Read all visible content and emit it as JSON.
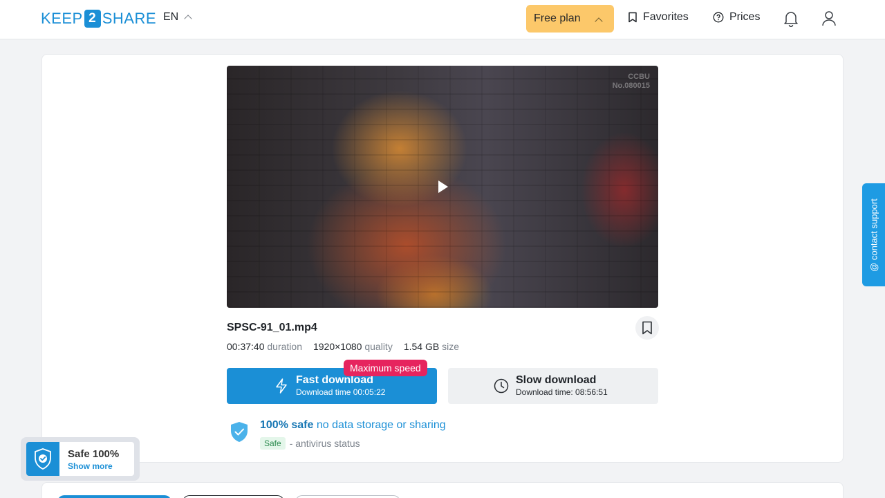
{
  "header": {
    "logo_left": "KEEP",
    "logo_mid": "2",
    "logo_right": "SHARE",
    "lang": "EN",
    "free_plan": "Free plan",
    "favorites": "Favorites",
    "prices": "Prices"
  },
  "video": {
    "watermark_line1": "CCBU",
    "watermark_line2": "No.080015"
  },
  "file": {
    "name": "SPSC-91_01.mp4",
    "duration_value": "00:37:40",
    "duration_label": "duration",
    "quality_value": "1920×1080",
    "quality_label": "quality",
    "size_value": "1.54 GB",
    "size_label": "size"
  },
  "download": {
    "badge": "Maximum speed",
    "fast_title": "Fast download",
    "fast_sub": "Download time 00:05:22",
    "slow_title": "Slow download",
    "slow_sub": "Download time: 08:56:51"
  },
  "safety": {
    "bold": "100% safe",
    "rest": " no data storage or sharing",
    "chip": "Safe",
    "status": "- antivirus status"
  },
  "floater": {
    "title": "Safe 100%",
    "link": "Show more"
  },
  "support": {
    "label": "@ contact support"
  },
  "colors": {
    "brand": "#1b8fd6",
    "free_plan": "#fcc86a",
    "badge": "#e6245e"
  }
}
